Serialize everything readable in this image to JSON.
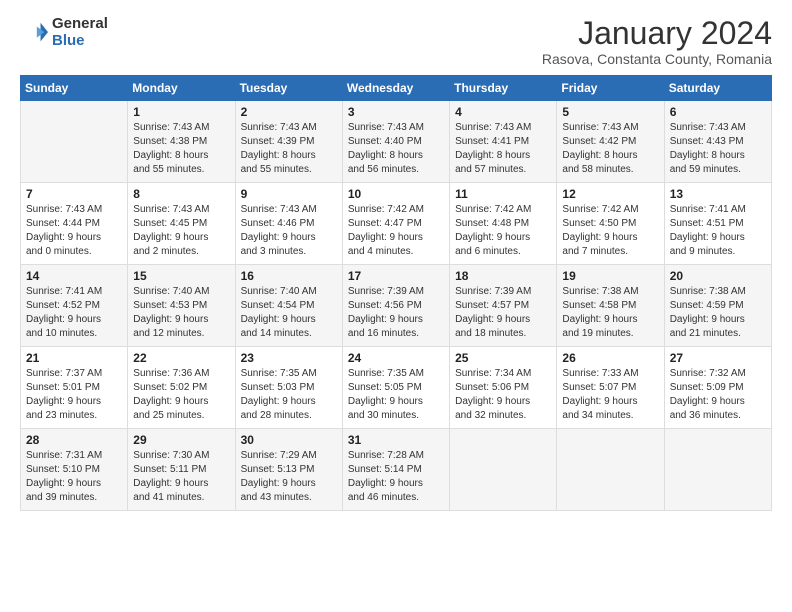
{
  "logo": {
    "general": "General",
    "blue": "Blue"
  },
  "title": "January 2024",
  "subtitle": "Rasova, Constanta County, Romania",
  "days_header": [
    "Sunday",
    "Monday",
    "Tuesday",
    "Wednesday",
    "Thursday",
    "Friday",
    "Saturday"
  ],
  "weeks": [
    [
      {
        "day": "",
        "info": ""
      },
      {
        "day": "1",
        "info": "Sunrise: 7:43 AM\nSunset: 4:38 PM\nDaylight: 8 hours\nand 55 minutes."
      },
      {
        "day": "2",
        "info": "Sunrise: 7:43 AM\nSunset: 4:39 PM\nDaylight: 8 hours\nand 55 minutes."
      },
      {
        "day": "3",
        "info": "Sunrise: 7:43 AM\nSunset: 4:40 PM\nDaylight: 8 hours\nand 56 minutes."
      },
      {
        "day": "4",
        "info": "Sunrise: 7:43 AM\nSunset: 4:41 PM\nDaylight: 8 hours\nand 57 minutes."
      },
      {
        "day": "5",
        "info": "Sunrise: 7:43 AM\nSunset: 4:42 PM\nDaylight: 8 hours\nand 58 minutes."
      },
      {
        "day": "6",
        "info": "Sunrise: 7:43 AM\nSunset: 4:43 PM\nDaylight: 8 hours\nand 59 minutes."
      }
    ],
    [
      {
        "day": "7",
        "info": "Sunrise: 7:43 AM\nSunset: 4:44 PM\nDaylight: 9 hours\nand 0 minutes."
      },
      {
        "day": "8",
        "info": "Sunrise: 7:43 AM\nSunset: 4:45 PM\nDaylight: 9 hours\nand 2 minutes."
      },
      {
        "day": "9",
        "info": "Sunrise: 7:43 AM\nSunset: 4:46 PM\nDaylight: 9 hours\nand 3 minutes."
      },
      {
        "day": "10",
        "info": "Sunrise: 7:42 AM\nSunset: 4:47 PM\nDaylight: 9 hours\nand 4 minutes."
      },
      {
        "day": "11",
        "info": "Sunrise: 7:42 AM\nSunset: 4:48 PM\nDaylight: 9 hours\nand 6 minutes."
      },
      {
        "day": "12",
        "info": "Sunrise: 7:42 AM\nSunset: 4:50 PM\nDaylight: 9 hours\nand 7 minutes."
      },
      {
        "day": "13",
        "info": "Sunrise: 7:41 AM\nSunset: 4:51 PM\nDaylight: 9 hours\nand 9 minutes."
      }
    ],
    [
      {
        "day": "14",
        "info": "Sunrise: 7:41 AM\nSunset: 4:52 PM\nDaylight: 9 hours\nand 10 minutes."
      },
      {
        "day": "15",
        "info": "Sunrise: 7:40 AM\nSunset: 4:53 PM\nDaylight: 9 hours\nand 12 minutes."
      },
      {
        "day": "16",
        "info": "Sunrise: 7:40 AM\nSunset: 4:54 PM\nDaylight: 9 hours\nand 14 minutes."
      },
      {
        "day": "17",
        "info": "Sunrise: 7:39 AM\nSunset: 4:56 PM\nDaylight: 9 hours\nand 16 minutes."
      },
      {
        "day": "18",
        "info": "Sunrise: 7:39 AM\nSunset: 4:57 PM\nDaylight: 9 hours\nand 18 minutes."
      },
      {
        "day": "19",
        "info": "Sunrise: 7:38 AM\nSunset: 4:58 PM\nDaylight: 9 hours\nand 19 minutes."
      },
      {
        "day": "20",
        "info": "Sunrise: 7:38 AM\nSunset: 4:59 PM\nDaylight: 9 hours\nand 21 minutes."
      }
    ],
    [
      {
        "day": "21",
        "info": "Sunrise: 7:37 AM\nSunset: 5:01 PM\nDaylight: 9 hours\nand 23 minutes."
      },
      {
        "day": "22",
        "info": "Sunrise: 7:36 AM\nSunset: 5:02 PM\nDaylight: 9 hours\nand 25 minutes."
      },
      {
        "day": "23",
        "info": "Sunrise: 7:35 AM\nSunset: 5:03 PM\nDaylight: 9 hours\nand 28 minutes."
      },
      {
        "day": "24",
        "info": "Sunrise: 7:35 AM\nSunset: 5:05 PM\nDaylight: 9 hours\nand 30 minutes."
      },
      {
        "day": "25",
        "info": "Sunrise: 7:34 AM\nSunset: 5:06 PM\nDaylight: 9 hours\nand 32 minutes."
      },
      {
        "day": "26",
        "info": "Sunrise: 7:33 AM\nSunset: 5:07 PM\nDaylight: 9 hours\nand 34 minutes."
      },
      {
        "day": "27",
        "info": "Sunrise: 7:32 AM\nSunset: 5:09 PM\nDaylight: 9 hours\nand 36 minutes."
      }
    ],
    [
      {
        "day": "28",
        "info": "Sunrise: 7:31 AM\nSunset: 5:10 PM\nDaylight: 9 hours\nand 39 minutes."
      },
      {
        "day": "29",
        "info": "Sunrise: 7:30 AM\nSunset: 5:11 PM\nDaylight: 9 hours\nand 41 minutes."
      },
      {
        "day": "30",
        "info": "Sunrise: 7:29 AM\nSunset: 5:13 PM\nDaylight: 9 hours\nand 43 minutes."
      },
      {
        "day": "31",
        "info": "Sunrise: 7:28 AM\nSunset: 5:14 PM\nDaylight: 9 hours\nand 46 minutes."
      },
      {
        "day": "",
        "info": ""
      },
      {
        "day": "",
        "info": ""
      },
      {
        "day": "",
        "info": ""
      }
    ]
  ]
}
